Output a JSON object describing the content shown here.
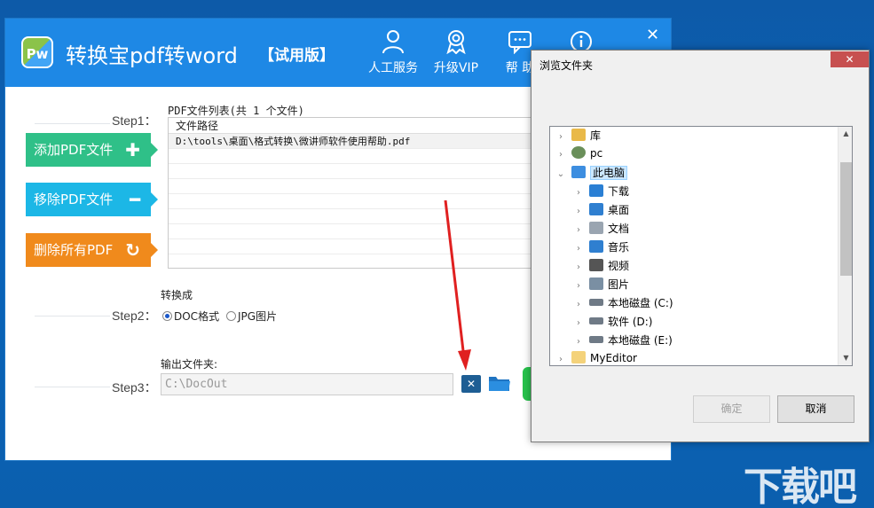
{
  "app": {
    "logo_text": "Pw",
    "title": "转换宝pdf转word",
    "edition": "【试用版】",
    "header_buttons": [
      {
        "label": "人工服务",
        "icon": "person-icon"
      },
      {
        "label": "升级VIP",
        "icon": "badge-icon"
      },
      {
        "label": "帮 助",
        "icon": "chat-icon"
      },
      {
        "label": "",
        "icon": "info-icon"
      }
    ],
    "close_glyph": "✕"
  },
  "steps": {
    "step1_label": "Step1：",
    "step2_label": "Step2：",
    "step3_label": "Step3："
  },
  "side_buttons": {
    "add": {
      "label": "添加PDF文件",
      "glyph": "✚",
      "color": "#2fc088"
    },
    "remove": {
      "label": "移除PDF文件",
      "glyph": "━",
      "color": "#1cb7e6"
    },
    "clear": {
      "label": "删除所有PDF",
      "glyph": "↻",
      "color": "#f08a1c"
    }
  },
  "file_list": {
    "title": "PDF文件列表(共 1 个文件)",
    "column_header": "文件路径",
    "rows": [
      "D:\\tools\\桌面\\格式转换\\微讲师软件使用帮助.pdf",
      "",
      "",
      "",
      "",
      "",
      "",
      ""
    ]
  },
  "convert": {
    "label": "转换成",
    "options": [
      {
        "label": "DOC格式",
        "selected": true
      },
      {
        "label": "JPG图片",
        "selected": false
      }
    ]
  },
  "output": {
    "label": "输出文件夹:",
    "value": "C:\\DocOut",
    "clear_glyph": "✕"
  },
  "dialog": {
    "title": "浏览文件夹",
    "close_glyph": "✕",
    "tree": [
      {
        "label": "库",
        "level": 0,
        "chevron": "›",
        "icon": "library-icon",
        "color": "#e9b949"
      },
      {
        "label": "pc",
        "level": 0,
        "chevron": "›",
        "icon": "user-icon",
        "color": "#6a8f5a"
      },
      {
        "label": "此电脑",
        "level": 0,
        "chevron": "⌄",
        "icon": "computer-icon",
        "color": "#3d8ee0",
        "selected": true
      },
      {
        "label": "下载",
        "level": 1,
        "chevron": "›",
        "icon": "download-icon",
        "color": "#2a7fd4"
      },
      {
        "label": "桌面",
        "level": 1,
        "chevron": "›",
        "icon": "desktop-icon",
        "color": "#2f7fd0"
      },
      {
        "label": "文档",
        "level": 1,
        "chevron": "›",
        "icon": "documents-icon",
        "color": "#9aa5b1"
      },
      {
        "label": "音乐",
        "level": 1,
        "chevron": "›",
        "icon": "music-icon",
        "color": "#2f7fd0"
      },
      {
        "label": "视频",
        "level": 1,
        "chevron": "›",
        "icon": "video-icon",
        "color": "#555555"
      },
      {
        "label": "图片",
        "level": 1,
        "chevron": "›",
        "icon": "pictures-icon",
        "color": "#7a8fa3"
      },
      {
        "label": "本地磁盘 (C:)",
        "level": 1,
        "chevron": "›",
        "icon": "drive-c-icon",
        "color": "#6f7a86"
      },
      {
        "label": "软件 (D:)",
        "level": 1,
        "chevron": "›",
        "icon": "drive-d-icon",
        "color": "#6f7a86"
      },
      {
        "label": "本地磁盘 (E:)",
        "level": 1,
        "chevron": "›",
        "icon": "drive-e-icon",
        "color": "#6f7a86"
      },
      {
        "label": "MyEditor",
        "level": 0,
        "chevron": "›",
        "icon": "folder-icon",
        "color": "#f4d27a"
      }
    ],
    "ok_label": "确定",
    "cancel_label": "取消"
  },
  "watermark": "下载吧"
}
